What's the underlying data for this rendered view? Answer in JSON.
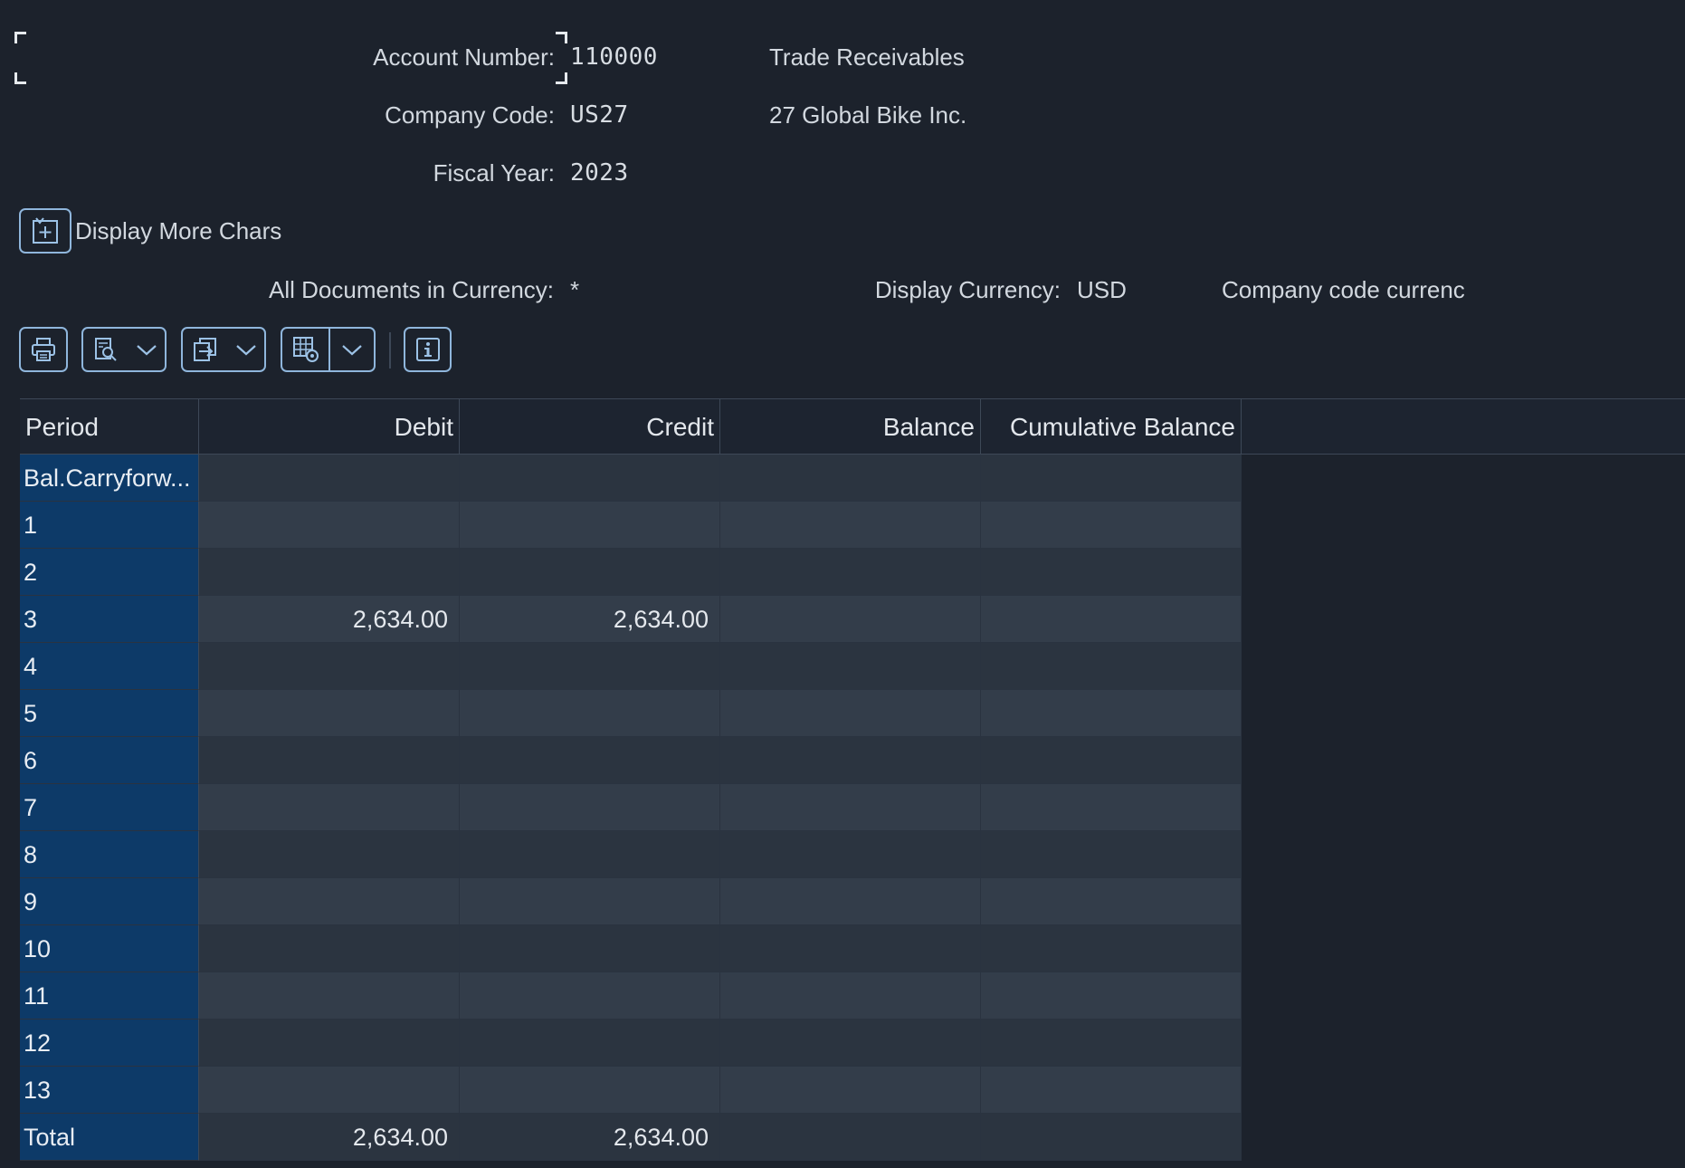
{
  "header": {
    "account_number_label": "Account Number:",
    "account_number_value": "110000",
    "account_desc": "Trade Receivables",
    "company_code_label": "Company Code:",
    "company_code_value": "US27",
    "company_desc": "27 Global Bike Inc.",
    "fiscal_year_label": "Fiscal Year:",
    "fiscal_year_value": "2023",
    "more_chars_label": "Display More Chars",
    "all_docs_label": "All Documents in Currency:",
    "all_docs_value": "*",
    "display_currency_label": "Display Currency:",
    "display_currency_value": "USD",
    "currency_desc": "Company code currenc"
  },
  "toolbar": {
    "icons": [
      "print-icon",
      "details-icon",
      "export-icon",
      "layout-settings-icon",
      "info-icon"
    ]
  },
  "grid": {
    "columns": [
      "Period",
      "Debit",
      "Credit",
      "Balance",
      "Cumulative Balance"
    ],
    "rows": [
      {
        "period": "Bal.Carryforw...",
        "debit": "",
        "credit": "",
        "balance": "",
        "cumulative": ""
      },
      {
        "period": "1",
        "debit": "",
        "credit": "",
        "balance": "",
        "cumulative": ""
      },
      {
        "period": "2",
        "debit": "",
        "credit": "",
        "balance": "",
        "cumulative": ""
      },
      {
        "period": "3",
        "debit": "2,634.00",
        "credit": "2,634.00",
        "balance": "",
        "cumulative": ""
      },
      {
        "period": "4",
        "debit": "",
        "credit": "",
        "balance": "",
        "cumulative": ""
      },
      {
        "period": "5",
        "debit": "",
        "credit": "",
        "balance": "",
        "cumulative": ""
      },
      {
        "period": "6",
        "debit": "",
        "credit": "",
        "balance": "",
        "cumulative": ""
      },
      {
        "period": "7",
        "debit": "",
        "credit": "",
        "balance": "",
        "cumulative": ""
      },
      {
        "period": "8",
        "debit": "",
        "credit": "",
        "balance": "",
        "cumulative": ""
      },
      {
        "period": "9",
        "debit": "",
        "credit": "",
        "balance": "",
        "cumulative": ""
      },
      {
        "period": "10",
        "debit": "",
        "credit": "",
        "balance": "",
        "cumulative": ""
      },
      {
        "period": "11",
        "debit": "",
        "credit": "",
        "balance": "",
        "cumulative": ""
      },
      {
        "period": "12",
        "debit": "",
        "credit": "",
        "balance": "",
        "cumulative": ""
      },
      {
        "period": "13",
        "debit": "",
        "credit": "",
        "balance": "",
        "cumulative": ""
      },
      {
        "period": "Total",
        "debit": "2,634.00",
        "credit": "2,634.00",
        "balance": "",
        "cumulative": ""
      }
    ]
  },
  "colors": {
    "background": "#1c222c",
    "period_cell": "#0d3a68",
    "accent_border": "#8fb6dc"
  }
}
